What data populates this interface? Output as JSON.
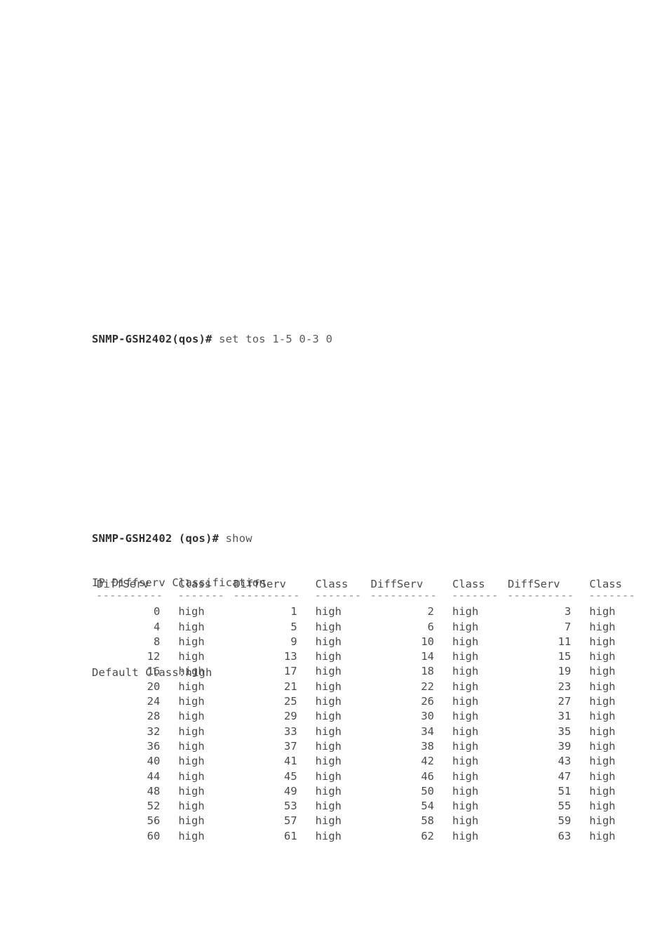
{
  "document": {
    "background": "#ffffff",
    "text_color": "#4a4a4a",
    "prompt_color": "#303030"
  },
  "command_block_1": {
    "prompt": "SNMP-GSH2402(qos)#",
    "command": " set tos 1-5 0-3 0",
    "full_line": "SNMP-GSH2402(qos)# set tos 1-5 0-3 0"
  },
  "command_block_2": {
    "prompt": "SNMP-GSH2402 (qos)#",
    "command": " show",
    "full_line": "SNMP-GSH2402 (qos)# show",
    "output_title": "IP Diffserv Classification",
    "blank_1": " ",
    "default_class_line": "Default Class:high",
    "blank_2": " "
  },
  "table": {
    "headers": [
      "DiffServ",
      "Class",
      "DiffServ",
      "Class",
      "DiffServ",
      "Class",
      "DiffServ",
      "Class"
    ],
    "rule_diffserv": "----------",
    "rule_class": "-------",
    "rows": [
      [
        "0",
        "high",
        "1",
        "high",
        "2",
        "high",
        "3",
        "high"
      ],
      [
        "4",
        "high",
        "5",
        "high",
        "6",
        "high",
        "7",
        "high"
      ],
      [
        "8",
        "high",
        "9",
        "high",
        "10",
        "high",
        "11",
        "high"
      ],
      [
        "12",
        "high",
        "13",
        "high",
        "14",
        "high",
        "15",
        "high"
      ],
      [
        "16",
        "high",
        "17",
        "high",
        "18",
        "high",
        "19",
        "high"
      ],
      [
        "20",
        "high",
        "21",
        "high",
        "22",
        "high",
        "23",
        "high"
      ],
      [
        "24",
        "high",
        "25",
        "high",
        "26",
        "high",
        "27",
        "high"
      ],
      [
        "28",
        "high",
        "29",
        "high",
        "30",
        "high",
        "31",
        "high"
      ],
      [
        "32",
        "high",
        "33",
        "high",
        "34",
        "high",
        "35",
        "high"
      ],
      [
        "36",
        "high",
        "37",
        "high",
        "38",
        "high",
        "39",
        "high"
      ],
      [
        "40",
        "high",
        "41",
        "high",
        "42",
        "high",
        "43",
        "high"
      ],
      [
        "44",
        "high",
        "45",
        "high",
        "46",
        "high",
        "47",
        "high"
      ],
      [
        "48",
        "high",
        "49",
        "high",
        "50",
        "high",
        "51",
        "high"
      ],
      [
        "52",
        "high",
        "53",
        "high",
        "54",
        "high",
        "55",
        "high"
      ],
      [
        "56",
        "high",
        "57",
        "high",
        "58",
        "high",
        "59",
        "high"
      ],
      [
        "60",
        "high",
        "61",
        "high",
        "62",
        "high",
        "63",
        "high"
      ]
    ]
  }
}
